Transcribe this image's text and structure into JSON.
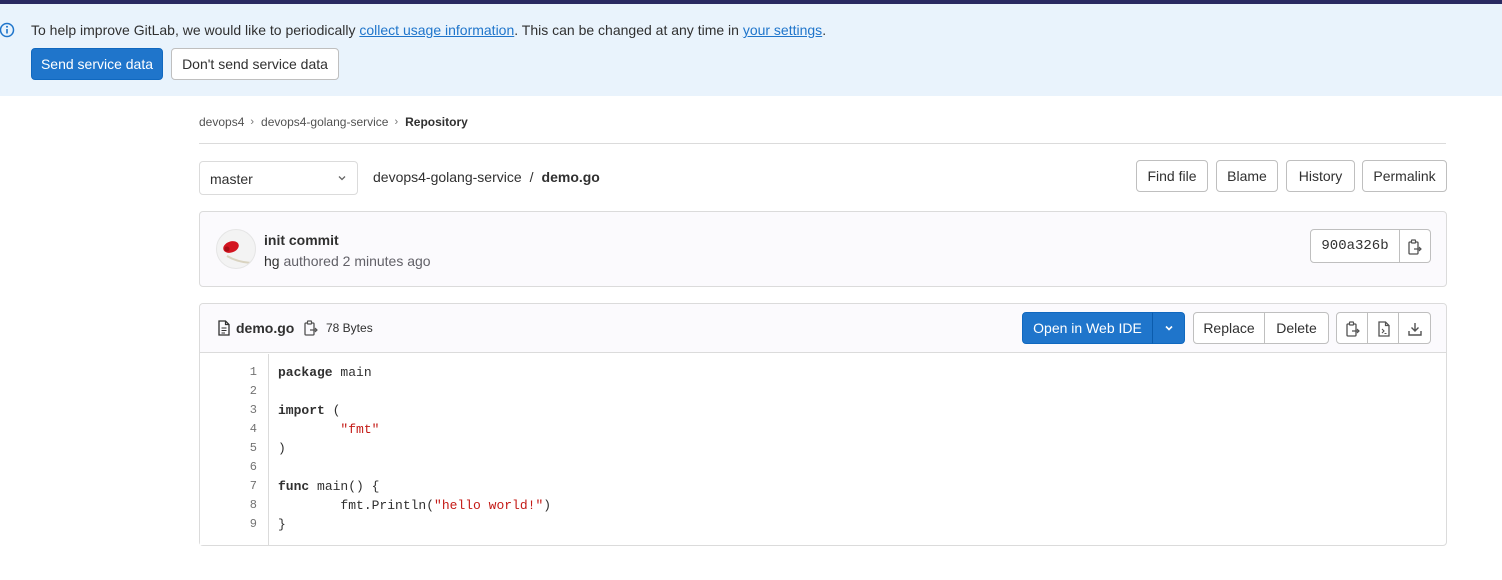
{
  "banner": {
    "text_prefix": "To help improve GitLab, we would like to periodically ",
    "link1": "collect usage information",
    "text_middle": ". This can be changed at any time in ",
    "link2": "your settings",
    "text_suffix": ".",
    "send_label": "Send service data",
    "nosend_label": "Don't send service data"
  },
  "breadcrumb": {
    "items": [
      "devops4",
      "devops4-golang-service"
    ],
    "current": "Repository"
  },
  "branch": {
    "selected": "master"
  },
  "path": {
    "repo": "devops4-golang-service",
    "separator": "/",
    "file": "demo.go"
  },
  "toolbar": {
    "find_file": "Find file",
    "blame": "Blame",
    "history": "History",
    "permalink": "Permalink"
  },
  "commit": {
    "title": "init commit",
    "author": "hg",
    "authored_text": "authored",
    "time": "2 minutes ago",
    "sha": "900a326b"
  },
  "file": {
    "name": "demo.go",
    "size": "78 Bytes",
    "open_ide": "Open in Web IDE",
    "replace": "Replace",
    "delete": "Delete"
  },
  "code": {
    "line_numbers": [
      "1",
      "2",
      "3",
      "4",
      "5",
      "6",
      "7",
      "8",
      "9"
    ],
    "lines": {
      "l1_kw": "package",
      "l1_rest": " main",
      "l3_kw": "import",
      "l3_rest": " (",
      "l4_indent": "        ",
      "l4_str": "\"fmt\"",
      "l5": ")",
      "l7_kw": "func",
      "l7_rest": " main() {",
      "l8_indent": "        ",
      "l8_pre": "fmt.Println(",
      "l8_str": "\"hello world!\"",
      "l8_post": ")",
      "l9": "}"
    }
  },
  "colors": {
    "accent": "#1f75cb",
    "banner_bg": "#e9f3fc",
    "topbar": "#292961",
    "string": "#c41a16"
  },
  "icons": [
    "info-icon",
    "chevron-right-icon",
    "chevron-down-icon",
    "file-icon",
    "copy-icon",
    "raw-file-icon",
    "open-raw-icon",
    "download-icon"
  ]
}
